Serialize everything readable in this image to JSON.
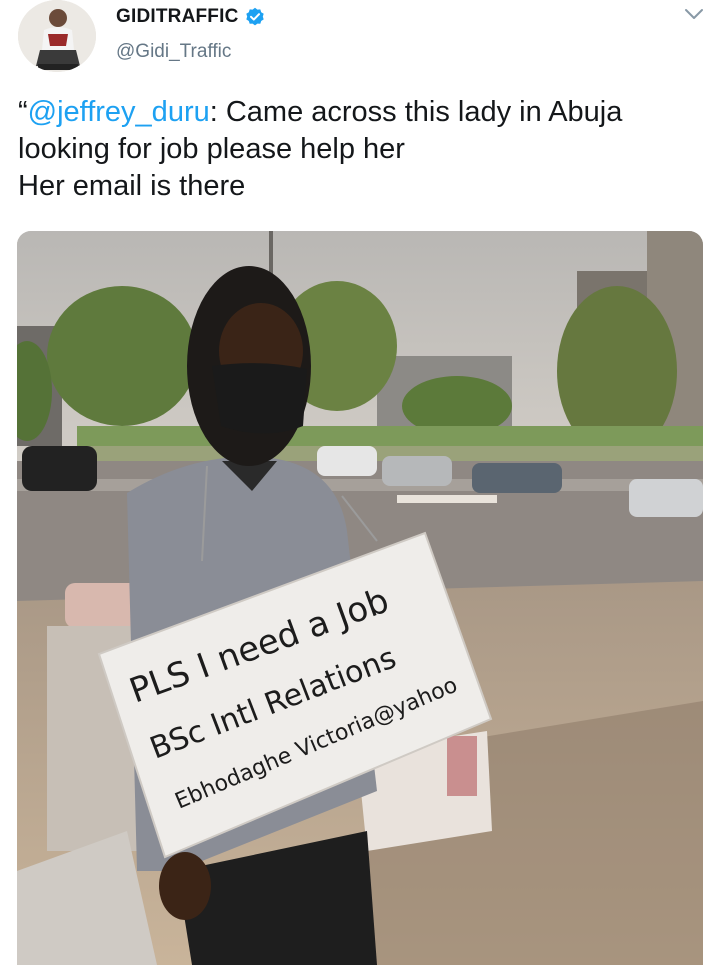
{
  "author": {
    "display_name": "GIDITRAFFIC",
    "handle": "@Gidi_Traffic",
    "verified": true,
    "avatar_icon": "profile-avatar"
  },
  "tweet": {
    "quote_open": "“",
    "mention": "@jeffrey_duru",
    "line1_rest": ": Came across this lady in Abuja",
    "line2": "looking for job please help her",
    "line3": "Her email is there"
  },
  "media": {
    "sign_lines": [
      "PLS I need a Job",
      "BSc Intl Relations",
      "Ebhodaghe Victoria@yahoo"
    ]
  },
  "colors": {
    "mention": "#1da1f2",
    "verified": "#1da1f2",
    "text": "#14171a",
    "secondary": "#657786"
  },
  "icons": {
    "verified": "verified-badge-icon",
    "menu": "chevron-down-icon"
  }
}
